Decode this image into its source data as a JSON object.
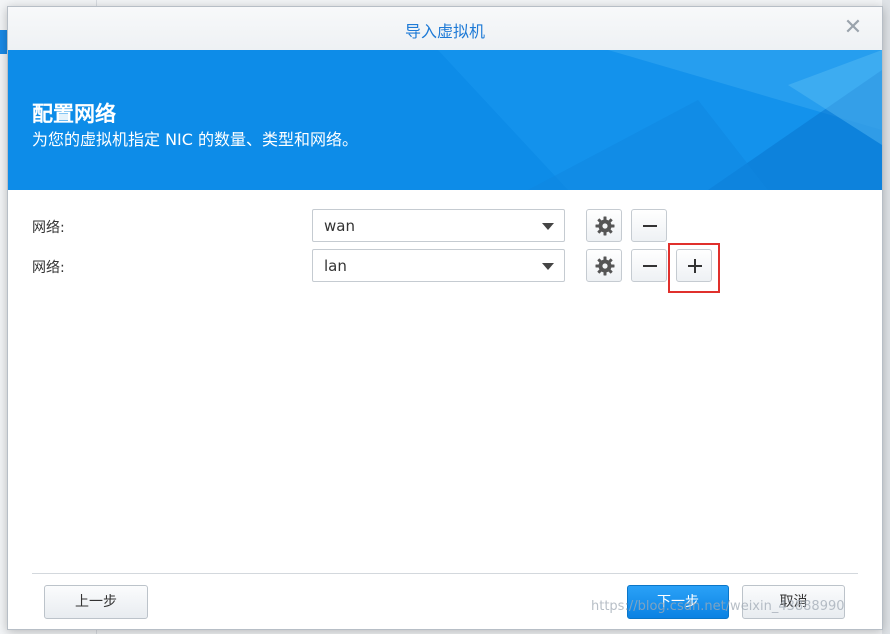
{
  "dialog": {
    "title": "导入虚拟机",
    "close_symbol": "✕"
  },
  "banner": {
    "title": "配置网络",
    "subtitle": "为您的虚拟机指定 NIC 的数量、类型和网络。"
  },
  "networks": [
    {
      "label": "网络:",
      "value": "wan"
    },
    {
      "label": "网络:",
      "value": "lan"
    }
  ],
  "footer": {
    "back_label": "上一步",
    "next_label": "下一步",
    "cancel_label": "取消"
  },
  "watermark": "https://blog.csdn.net/weixin_43888990",
  "colors": {
    "accent": "#0d8ce8",
    "title_text": "#1e7ad6",
    "highlight": "#e0302c"
  },
  "icons": [
    "close-icon",
    "gear-icon",
    "minus-icon",
    "plus-icon",
    "caret-down-icon"
  ]
}
